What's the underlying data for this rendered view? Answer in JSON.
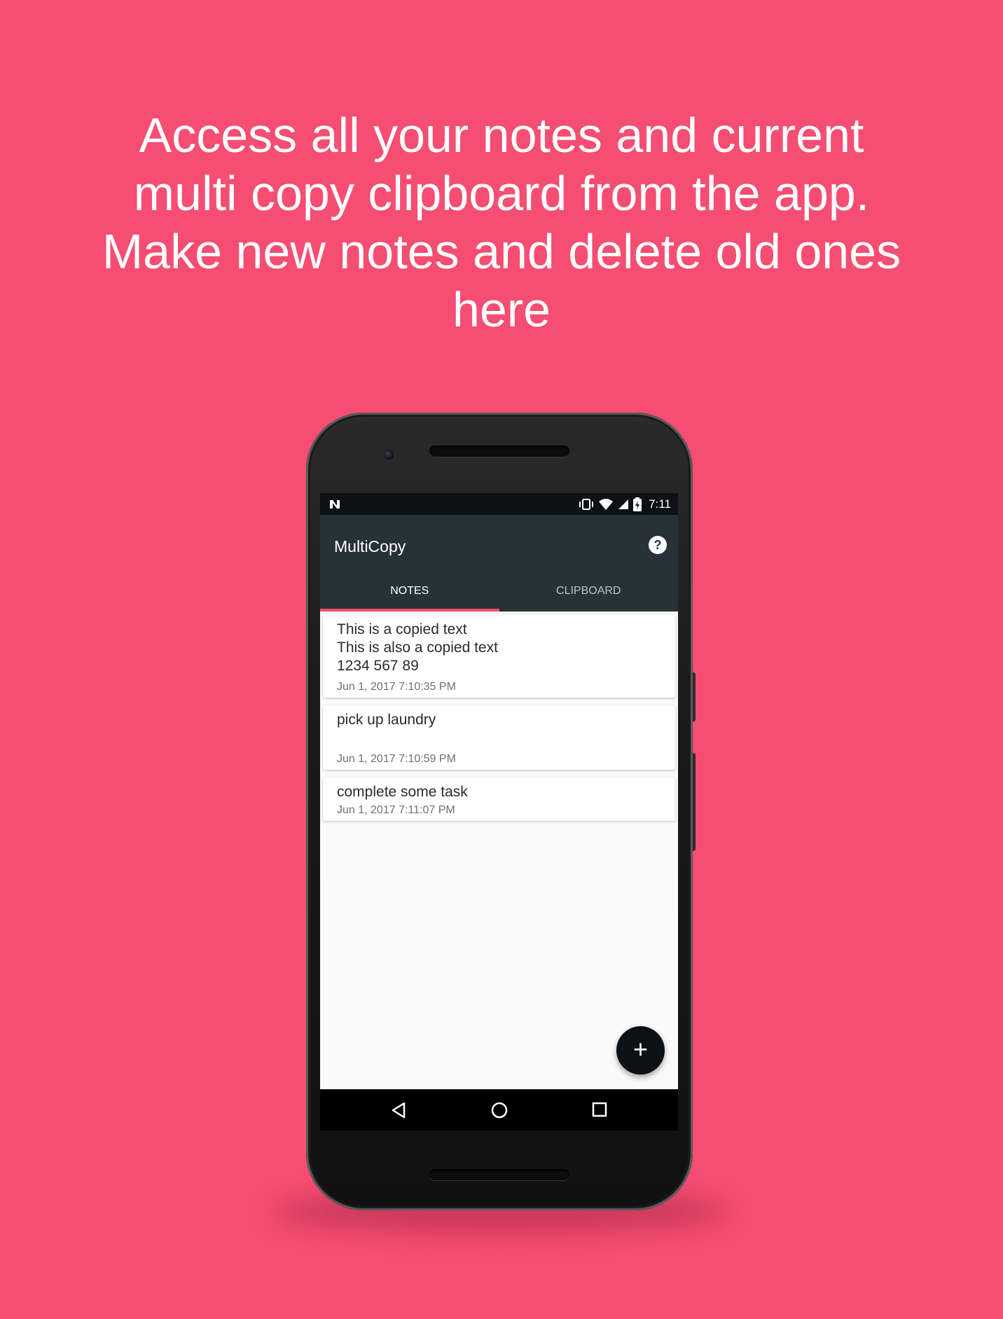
{
  "headline": {
    "lines": [
      "Access all your notes and current",
      "multi copy clipboard from the app.",
      "Make new notes and delete old ones",
      "here"
    ]
  },
  "status_bar": {
    "time": "7:11",
    "icons": [
      "notification-n-icon",
      "vibrate-icon",
      "wifi-icon",
      "cell-signal-icon",
      "battery-charging-icon"
    ]
  },
  "app_bar": {
    "title": "MultiCopy",
    "help_icon": "help-circle-icon"
  },
  "tabs": [
    {
      "label": "NOTES",
      "active": true
    },
    {
      "label": "CLIPBOARD",
      "active": false
    }
  ],
  "notes": [
    {
      "lines": [
        "This is a  copied text",
        "This is also a copied text",
        "1234 567 89"
      ],
      "date": "Jun 1, 2017 7:10:35 PM"
    },
    {
      "lines": [
        "pick up laundry"
      ],
      "date": "Jun 1, 2017 7:10:59 PM"
    },
    {
      "lines": [
        "complete some task"
      ],
      "date": "Jun 1, 2017 7:11:07 PM"
    }
  ],
  "fab": {
    "icon": "plus-icon",
    "symbol": "+"
  },
  "nav_bar": {
    "icons": [
      "back-icon",
      "home-icon",
      "recents-icon"
    ]
  },
  "colors": {
    "background": "#f64d72",
    "app_bar": "#273238",
    "status_bar": "#0b1116",
    "tab_indicator": "#f64d72"
  }
}
